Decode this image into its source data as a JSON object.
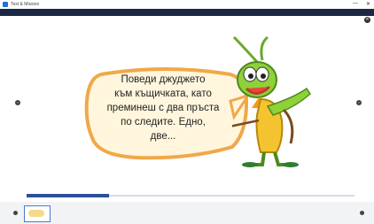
{
  "window": {
    "title": "Text & Mission",
    "controls": [
      "—",
      "✕"
    ]
  },
  "topband": {
    "left_text": "",
    "right_text": ""
  },
  "speech": {
    "lines": [
      "Поведи джуджето",
      "към къщичката, като",
      "преминеш с два пръста",
      "по следите. Едно,",
      "две..."
    ]
  },
  "progress": {
    "value": 0.25,
    "label": ""
  },
  "colors": {
    "accent": "#2c4f9a",
    "bubble_fill": "#fff6dd",
    "bubble_stroke": "#f0a84a",
    "topband": "#1b2744"
  },
  "icons": {
    "close": "close-icon",
    "prev": "chevron-left-icon",
    "next": "chevron-right-icon"
  }
}
